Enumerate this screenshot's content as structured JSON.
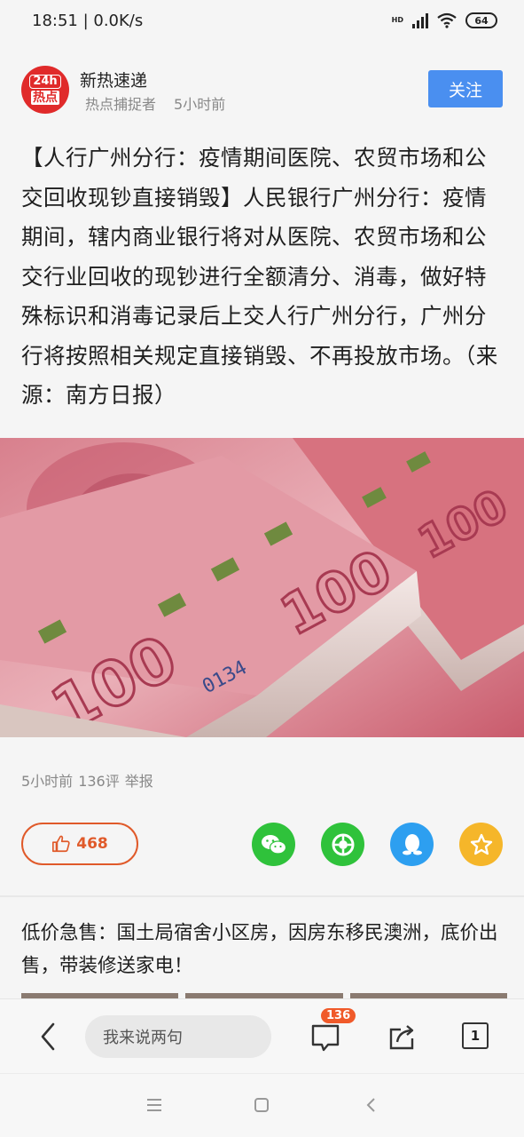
{
  "status": {
    "time_speed": "18:51 | 0.0K/s",
    "hd": "HD",
    "battery": "64"
  },
  "author": {
    "avatar_top": "24h",
    "avatar_bottom": "热点",
    "name": "新热速递",
    "tag": "热点捕捉者",
    "time": "5小时前",
    "follow_label": "关注"
  },
  "article": {
    "body": "【人行广州分行：疫情期间医院、农贸市场和公交回收现钞直接销毁】人民银行广州分行：疫情期间，辖内商业银行将对从医院、农贸市场和公交行业回收的现钞进行全额清分、消毒，做好特殊标识和消毒记录后上交人行广州分行，广州分行将按照相关规定直接销毁、不再投放市场。（来源：南方日报）"
  },
  "meta": {
    "time": "5小时前",
    "comments": "136评",
    "report": "举报"
  },
  "like": {
    "count": "468"
  },
  "ad": {
    "text": "低价急售：国土局宿舍小区房，因房东移民澳洲，底价出售，带装修送家电！"
  },
  "bottom_bar": {
    "comment_placeholder": "我来说两句",
    "comment_badge": "136",
    "tabs_count": "1"
  },
  "colors": {
    "accent_blue": "#4a8ff0",
    "like_orange": "#e05a2a",
    "wechat_green": "#2fc23b",
    "qq_blue": "#2d9ff0",
    "fav_yellow": "#f5b62a"
  }
}
